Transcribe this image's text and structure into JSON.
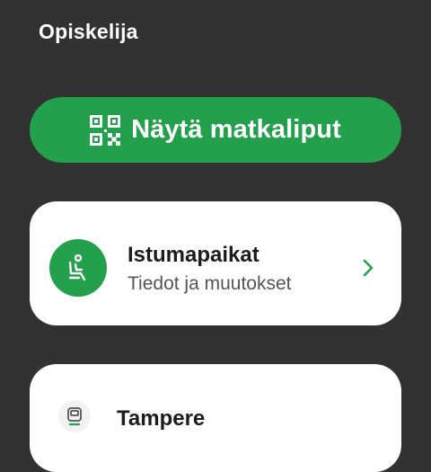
{
  "header": {
    "profile_label": "Opiskelija"
  },
  "primary_action": {
    "label": "Näytä matkaliput",
    "icon": "qr-code-icon"
  },
  "seats_card": {
    "title": "Istumapaikat",
    "subtitle": "Tiedot ja muutokset",
    "icon": "seat-icon",
    "chevron_icon": "chevron-right-icon"
  },
  "trip_card": {
    "title": "Tampere",
    "icon": "train-icon"
  },
  "colors": {
    "background": "#323232",
    "accent_green": "#22a04b",
    "card_background": "#ffffff",
    "text_primary": "#1c1c1c",
    "text_secondary": "#555555"
  }
}
